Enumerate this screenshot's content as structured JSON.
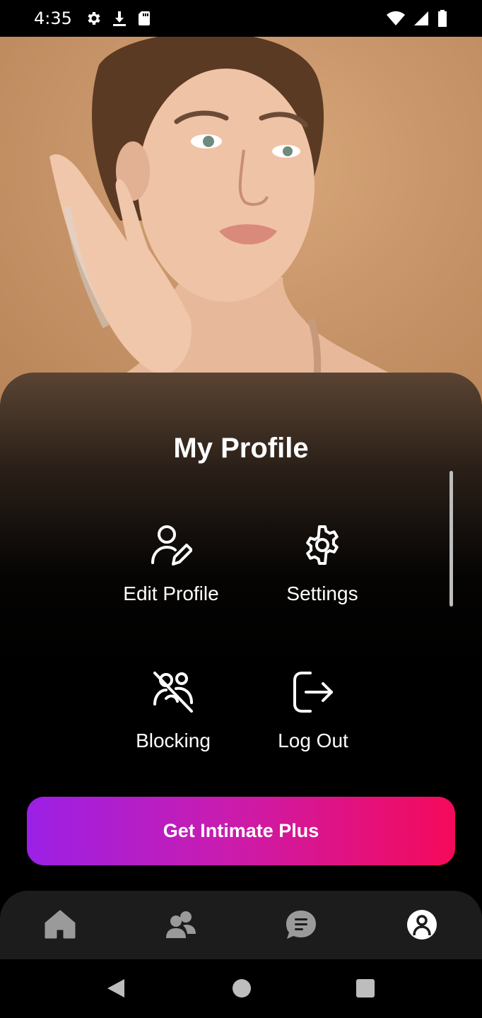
{
  "status_bar": {
    "time": "4:35",
    "left_icons": [
      "gear-icon",
      "download-icon",
      "sd-card-icon"
    ],
    "right_icons": [
      "wifi-icon",
      "signal-icon",
      "battery-icon"
    ]
  },
  "hero": {
    "image": "portrait-photo"
  },
  "profile": {
    "title": "My Profile",
    "menu": [
      {
        "label": "Edit Profile",
        "icon": "edit-profile-icon"
      },
      {
        "label": "Settings",
        "icon": "gear-icon"
      },
      {
        "label": "Blocking",
        "icon": "block-user-icon"
      },
      {
        "label": "Log Out",
        "icon": "logout-icon"
      }
    ],
    "cta_label": "Get Intimate Plus",
    "cta_gradient": [
      "#9b20e6",
      "#f50a5a"
    ]
  },
  "bottom_nav": {
    "items": [
      "home-icon",
      "people-icon",
      "chat-icon",
      "profile-icon"
    ],
    "active": "profile-icon"
  },
  "system_nav": [
    "back-button",
    "home-button",
    "recents-button"
  ]
}
